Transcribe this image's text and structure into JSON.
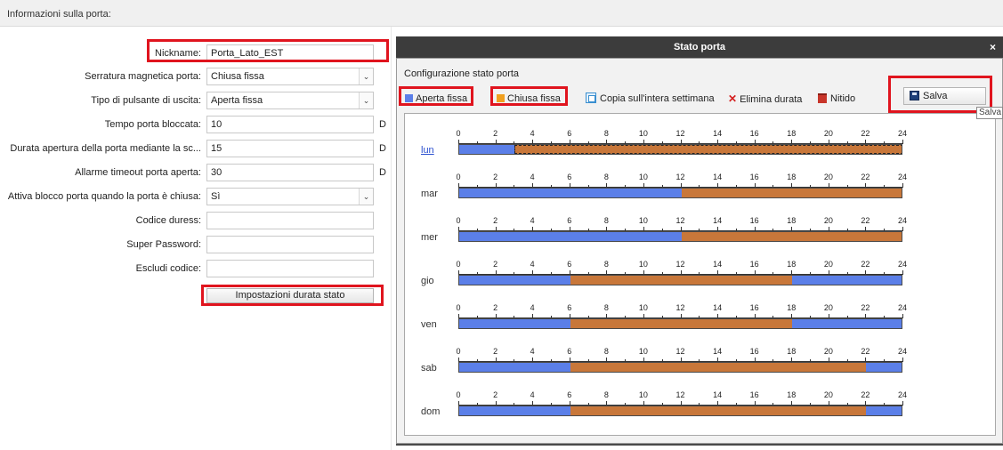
{
  "header": {
    "title": "Informazioni sulla porta:"
  },
  "form": {
    "nickname_label": "Nickname:",
    "nickname_value": "Porta_Lato_EST",
    "lock_label": "Serratura magnetica porta:",
    "lock_value": "Chiusa fissa",
    "exit_label": "Tipo di pulsante di uscita:",
    "exit_value": "Aperta fissa",
    "locked_time_label": "Tempo porta bloccata:",
    "locked_time_value": "10",
    "open_duration_label": "Durata apertura della porta mediante la sc...",
    "open_duration_value": "15",
    "timeout_label": "Allarme timeout porta aperta:",
    "timeout_value": "30",
    "lock_closed_label": "Attiva blocco porta quando la porta è chiusa:",
    "lock_closed_value": "Sì",
    "duress_label": "Codice duress:",
    "super_label": "Super Password:",
    "exclude_label": "Escludi codice:",
    "unit": "D",
    "settings_button": "Impostazioni durata stato"
  },
  "dialog": {
    "title": "Stato porta",
    "close": "×",
    "config_title": "Configurazione stato porta",
    "legend_open": "Aperta fissa",
    "legend_closed": "Chiusa fissa",
    "copy_week": "Copia sull'intera settimana",
    "delete_duration": "Elimina durata",
    "clear": "Nitido",
    "save": "Salva",
    "tooltip": "Salva"
  },
  "colors": {
    "open": "#5b7fe8",
    "closed": "#c8773a",
    "highlight": "#e0141e"
  },
  "schedule": {
    "hours": [
      "0",
      "2",
      "4",
      "6",
      "8",
      "10",
      "12",
      "14",
      "16",
      "18",
      "20",
      "22",
      "24"
    ],
    "days": [
      {
        "label": "lun",
        "link": true,
        "closed": [
          [
            3,
            24
          ]
        ]
      },
      {
        "label": "mar",
        "link": false,
        "closed": [
          [
            12,
            24
          ]
        ]
      },
      {
        "label": "mer",
        "link": false,
        "closed": [
          [
            12,
            24
          ]
        ]
      },
      {
        "label": "gio",
        "link": false,
        "closed": [
          [
            6,
            18
          ]
        ]
      },
      {
        "label": "ven",
        "link": false,
        "closed": [
          [
            6,
            18
          ]
        ]
      },
      {
        "label": "sab",
        "link": false,
        "closed": [
          [
            6,
            22
          ]
        ]
      },
      {
        "label": "dom",
        "link": false,
        "closed": [
          [
            6,
            22
          ]
        ]
      }
    ]
  }
}
